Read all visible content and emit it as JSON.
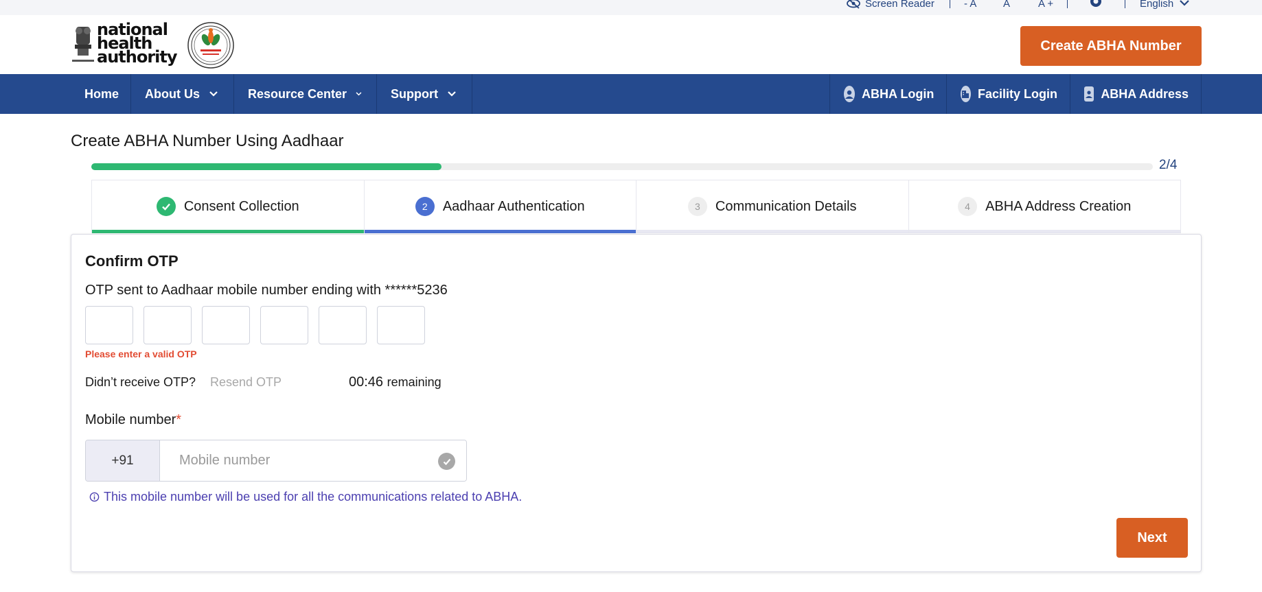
{
  "utility": {
    "screen_reader": "Screen Reader",
    "font_decrease": "- A",
    "font_normal": "A",
    "font_increase": "A +",
    "language": "English"
  },
  "header": {
    "logo_text_line1": "national",
    "logo_text_line2": "health",
    "logo_text_line3": "authority",
    "cta_label": "Create ABHA Number"
  },
  "nav": {
    "left": [
      {
        "label": "Home",
        "has_dropdown": false
      },
      {
        "label": "About Us",
        "has_dropdown": true
      },
      {
        "label": "Resource Center",
        "has_dropdown": true
      },
      {
        "label": "Support",
        "has_dropdown": true
      }
    ],
    "right": [
      {
        "label": "ABHA Login",
        "icon": "user-icon"
      },
      {
        "label": "Facility Login",
        "icon": "building-icon"
      },
      {
        "label": "ABHA Address",
        "icon": "id-card-icon"
      }
    ]
  },
  "page": {
    "title": "Create ABHA Number Using Aadhaar",
    "progress_text": "2/4",
    "progress_fraction": 0.33
  },
  "steps": [
    {
      "number": "1",
      "label": "Consent Collection",
      "state": "done"
    },
    {
      "number": "2",
      "label": "Aadhaar Authentication",
      "state": "active"
    },
    {
      "number": "3",
      "label": "Communication Details",
      "state": "pending"
    },
    {
      "number": "4",
      "label": "ABHA Address Creation",
      "state": "pending"
    }
  ],
  "otp": {
    "title": "Confirm OTP",
    "message": "OTP sent to Aadhaar mobile number ending with ******5236",
    "digits": [
      "",
      "",
      "",
      "",
      "",
      ""
    ],
    "error": "Please enter a valid OTP",
    "resend_question": "Didn’t receive OTP?",
    "resend_link": "Resend OTP",
    "timer_value": "00:46",
    "timer_suffix": "remaining"
  },
  "mobile": {
    "label": "Mobile number",
    "required_mark": "*",
    "prefix": "+91",
    "placeholder": "Mobile number",
    "value": "",
    "info": "This mobile number will be used for all the communications related to ABHA."
  },
  "actions": {
    "next_label": "Next"
  },
  "colors": {
    "brand_blue": "#254a8e",
    "accent_orange": "#d85f23",
    "success_green": "#2eb872",
    "active_step_blue": "#4a6fd1",
    "error_red": "#e24c33",
    "info_purple": "#4b3fb0"
  }
}
